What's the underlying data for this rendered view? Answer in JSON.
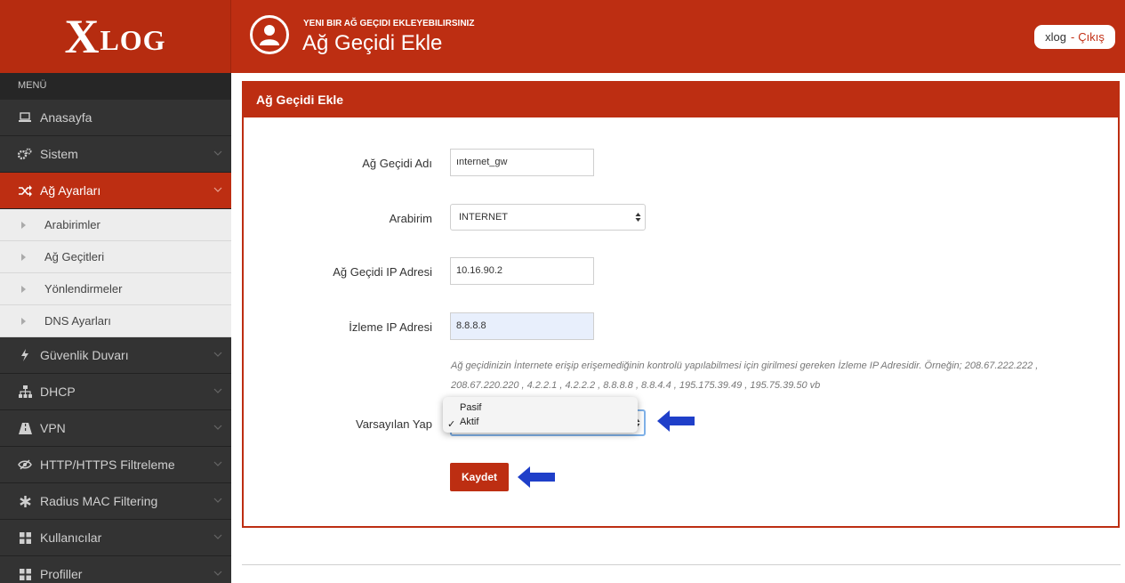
{
  "brand": {
    "logo_x": "X",
    "logo_rest": "LOG"
  },
  "header": {
    "subtitle": "YENI BIR AĞ GEÇIDI EKLEYEBILIRSINIZ",
    "title": "Ağ Geçidi Ekle",
    "user": "xlog",
    "separator": "-",
    "logout": "Çıkış"
  },
  "sidebar": {
    "header": "MENÜ",
    "items": [
      {
        "label": "Anasayfa",
        "icon": "laptop-icon"
      },
      {
        "label": "Sistem",
        "icon": "gears-icon"
      },
      {
        "label": "Ağ Ayarları",
        "icon": "shuffle-icon",
        "active": true
      },
      {
        "label": "Güvenlik Duvarı",
        "icon": "bolt-icon"
      },
      {
        "label": "DHCP",
        "icon": "sitemap-icon"
      },
      {
        "label": "VPN",
        "icon": "road-icon"
      },
      {
        "label": "HTTP/HTTPS Filtreleme",
        "icon": "eye-slash-icon"
      },
      {
        "label": "Radius MAC Filtering",
        "icon": "asterisk-icon"
      },
      {
        "label": "Kullanıcılar",
        "icon": "grid-icon"
      },
      {
        "label": "Profiller",
        "icon": "grid-icon"
      }
    ],
    "submenu": [
      "Arabirimler",
      "Ağ Geçitleri",
      "Yönlendirmeler",
      "DNS Ayarları"
    ]
  },
  "panel": {
    "title": "Ağ Geçidi Ekle",
    "fields": {
      "name_label": "Ağ Geçidi Adı",
      "name_value": "ınternet_gw",
      "interface_label": "Arabirim",
      "interface_value": "INTERNET",
      "ip_label": "Ağ Geçidi IP Adresi",
      "ip_value": "10.16.90.2",
      "monitor_label": "İzleme IP Adresi",
      "monitor_value": "8.8.8.8",
      "help_line1": "Ağ geçidinizin İnternete erişip erişemediğinin kontrolü yapılabilmesi için girilmesi gereken İzleme IP Adresidir. Örneğin; 208.67.222.222 ,",
      "help_line2": "208.67.220.220 , 4.2.2.1 , 4.2.2.2 , 8.8.8.8 , 8.8.4.4 , 195.175.39.49 , 195.75.39.50 vb",
      "default_label": "Varsayılan Yap",
      "default_options": [
        "Pasif",
        "Aktif"
      ],
      "default_selected": "Aktif",
      "checkmark": "✓"
    },
    "save_label": "Kaydet"
  },
  "colors": {
    "brand": "#bd2e12",
    "sidebar": "#2c2c2c",
    "arrow": "#1f3fc9"
  }
}
